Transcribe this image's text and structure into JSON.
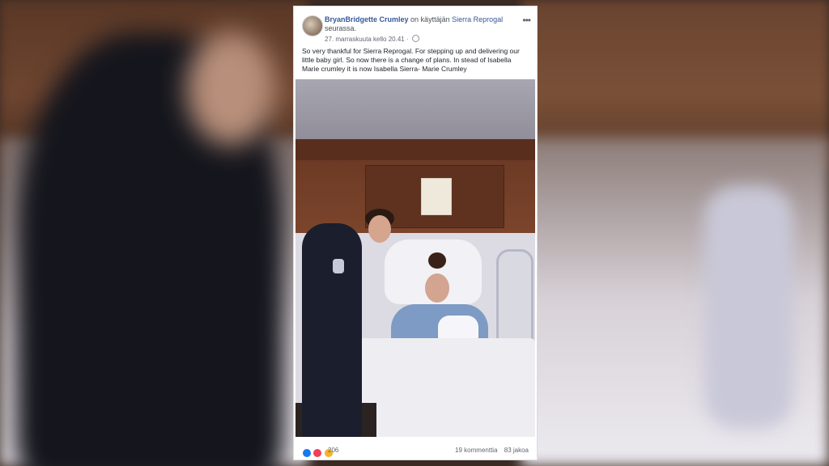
{
  "post": {
    "author": "BryanBridgette Crumley",
    "with_text": "on käyttäjän",
    "tagged": "Sierra Reprogal",
    "with_suffix": "seurassa.",
    "timestamp": "27. marraskuuta kello 20.41 ·",
    "body": "So very thankful for Sierra Reprogal. For stepping up and delivering our little baby girl. So now there is a change of plans. In stead of Isabella Marie crumley it is now Isabella Sierra- Marie Crumley",
    "more_label": "•••"
  },
  "footer": {
    "reactions_count": "206",
    "comments": "19 kommenttia",
    "shares": "83 jakoa",
    "reaction_icons": [
      "like-icon",
      "love-icon",
      "wow-icon"
    ]
  },
  "colors": {
    "link": "#385898",
    "like": "#1877f2",
    "love": "#f33e58",
    "wow": "#f7b125"
  }
}
